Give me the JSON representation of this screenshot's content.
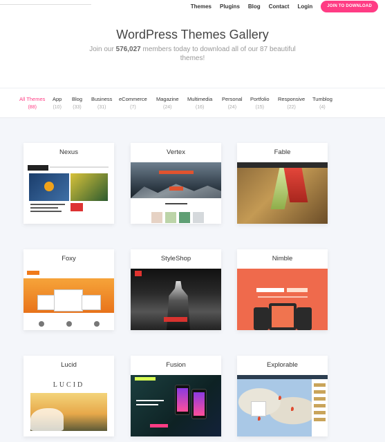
{
  "nav": {
    "items": [
      "Themes",
      "Plugins",
      "Blog",
      "Contact",
      "Login"
    ],
    "cta": "JOIN TO DOWNLOAD"
  },
  "hero": {
    "title": "WordPress Themes Gallery",
    "subtitle_before": "Join our ",
    "subtitle_count": "576,027",
    "subtitle_after": " members today to download all of our 87 beautiful themes!"
  },
  "filters": [
    {
      "label": "All Themes",
      "count": "(88)",
      "active": true
    },
    {
      "label": "App",
      "count": "(10)"
    },
    {
      "label": "Blog",
      "count": "(33)"
    },
    {
      "label": "Business",
      "count": "(31)"
    },
    {
      "label": "eCommerce",
      "count": "(7)"
    },
    {
      "label": "Magazine",
      "count": "(24)"
    },
    {
      "label": "Multimedia",
      "count": "(16)"
    },
    {
      "label": "Personal",
      "count": "(24)"
    },
    {
      "label": "Portfolio",
      "count": "(15)"
    },
    {
      "label": "Responsive",
      "count": "(22)"
    },
    {
      "label": "Tumblog",
      "count": "(4)"
    }
  ],
  "themes": [
    "Nexus",
    "Vertex",
    "Fable",
    "Foxy",
    "StyleShop",
    "Nimble",
    "Lucid",
    "Fusion",
    "Explorable"
  ],
  "thumb_text": {
    "nimble_line1": "Simple & Flexible",
    "lucid_word": "LUCID"
  },
  "colors": {
    "accent": "#ff3c84",
    "background": "#f4f6fa"
  }
}
